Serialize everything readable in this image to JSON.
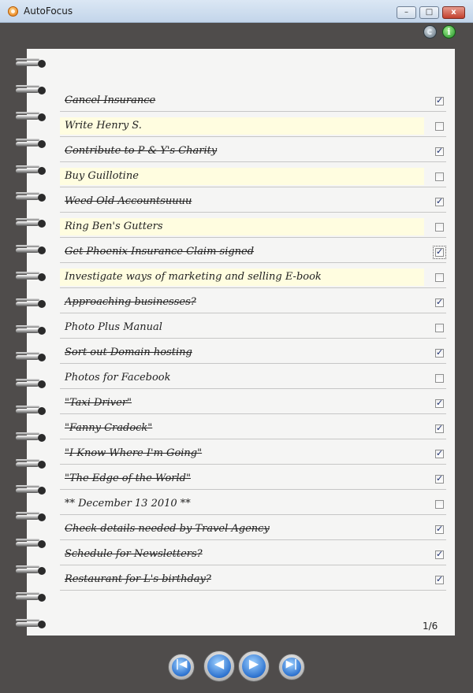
{
  "window": {
    "title": "AutoFocus",
    "minimize_label": "–",
    "maximize_label": "□",
    "close_label": "x"
  },
  "toolbar": {
    "icons": [
      "sync-icon",
      "info-icon"
    ],
    "info_glyph": "i"
  },
  "tasks": [
    {
      "text": "Cancel Insurance",
      "done": true,
      "highlighted": false
    },
    {
      "text": "Write Henry S.",
      "done": false,
      "highlighted": true
    },
    {
      "text": "Contribute to P & Y's Charity",
      "done": true,
      "highlighted": false
    },
    {
      "text": "Buy Guillotine",
      "done": false,
      "highlighted": true
    },
    {
      "text": "Weed Old Accountsuuuu",
      "done": true,
      "highlighted": false
    },
    {
      "text": "Ring Ben's Gutters",
      "done": false,
      "highlighted": true
    },
    {
      "text": "Get Phoenix Insurance Claim signed",
      "done": true,
      "highlighted": false,
      "focused": true
    },
    {
      "text": "Investigate ways of marketing and selling E-book",
      "done": false,
      "highlighted": true
    },
    {
      "text": "Approaching businesses?",
      "done": true,
      "highlighted": false
    },
    {
      "text": "Photo Plus Manual",
      "done": false,
      "highlighted": false
    },
    {
      "text": "Sort out Domain hosting",
      "done": true,
      "highlighted": false
    },
    {
      "text": "Photos for Facebook",
      "done": false,
      "highlighted": false
    },
    {
      "text": "\"Taxi Driver\"",
      "done": true,
      "highlighted": false
    },
    {
      "text": "\"Fanny Cradock\"",
      "done": true,
      "highlighted": false
    },
    {
      "text": "\"I Know Where I'm Going\"",
      "done": true,
      "highlighted": false
    },
    {
      "text": "\"The Edge of the World\"",
      "done": true,
      "highlighted": false
    },
    {
      "text": "** December 13 2010 **",
      "done": false,
      "highlighted": false
    },
    {
      "text": "Check details needed by Travel Agency",
      "done": true,
      "highlighted": false
    },
    {
      "text": "Schedule for Newsletters?",
      "done": true,
      "highlighted": false
    },
    {
      "text": "Restaurant for L's birthday?",
      "done": true,
      "highlighted": false
    }
  ],
  "pagination": {
    "indicator": "1/6",
    "first_glyph": "|◀",
    "prev_glyph": "◀",
    "next_glyph": "▶",
    "last_glyph": "▶|"
  },
  "colors": {
    "highlight": "#fffde0",
    "background": "#4f4c4b",
    "check": "#1d2f6e"
  }
}
